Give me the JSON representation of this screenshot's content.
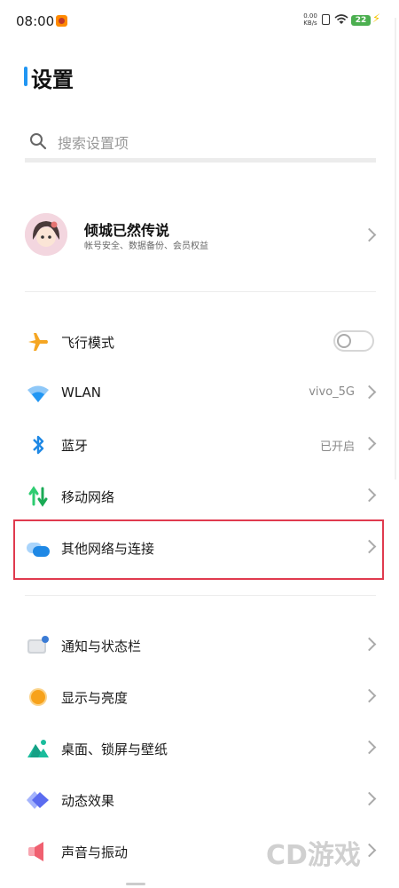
{
  "status_bar": {
    "time": "08:00",
    "net_speed_value": "0.00",
    "net_speed_unit": "KB/s",
    "battery": "22"
  },
  "page": {
    "title": "设置"
  },
  "search": {
    "placeholder": "搜索设置项"
  },
  "account": {
    "name": "倾城已然传说",
    "subtitle": "帐号安全、数据备份、会员权益"
  },
  "network_section": {
    "airplane": {
      "label": "飞行模式",
      "toggle_on": false
    },
    "wlan": {
      "label": "WLAN",
      "value": "vivo_5G"
    },
    "bluetooth": {
      "label": "蓝牙",
      "value": "已开启"
    },
    "mobile_network": {
      "label": "移动网络"
    },
    "other_connections": {
      "label": "其他网络与连接"
    }
  },
  "display_section": {
    "notifications": {
      "label": "通知与状态栏"
    },
    "display": {
      "label": "显示与亮度"
    },
    "wallpaper": {
      "label": "桌面、锁屏与壁纸"
    },
    "animation": {
      "label": "动态效果"
    },
    "sound": {
      "label": "声音与振动"
    }
  },
  "watermark": "CD游戏",
  "colors": {
    "accent_blue": "#2196f3",
    "highlight_red": "#e03a4e",
    "airplane_orange": "#f5a623",
    "mobile_green": "#2ecc71",
    "display_orange": "#f7a21b",
    "sound_red": "#f06070"
  }
}
